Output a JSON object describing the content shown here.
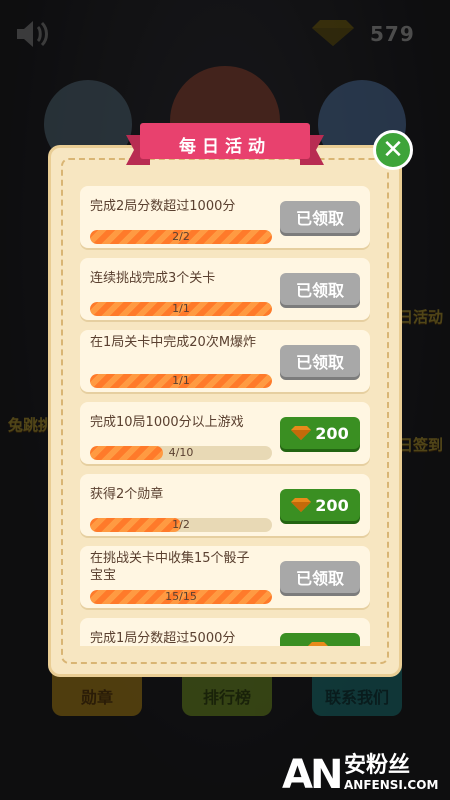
{
  "hud": {
    "gem_count": "579"
  },
  "background": {
    "side_right_1": "日活动",
    "side_right_2": "日签到",
    "side_left_1": "兔跳挑",
    "bottom_buttons": [
      "勋章",
      "排行榜",
      "联系我们"
    ]
  },
  "dialog": {
    "title": "每日活动",
    "close_label": "✕",
    "tasks": [
      {
        "title": "完成2局分数超过1000分",
        "progress_text": "2/2",
        "progress": 1.0,
        "status": "claimed",
        "button": "已领取"
      },
      {
        "title": "连续挑战完成3个关卡",
        "progress_text": "1/1",
        "progress": 1.0,
        "status": "claimed",
        "button": "已领取"
      },
      {
        "title": "在1局关卡中完成20次M爆炸",
        "progress_text": "1/1",
        "progress": 1.0,
        "status": "claimed",
        "button": "已领取"
      },
      {
        "title": "完成10局1000分以上游戏",
        "progress_text": "4/10",
        "progress": 0.4,
        "status": "reward",
        "button": "200"
      },
      {
        "title": "获得2个勋章",
        "progress_text": "1/2",
        "progress": 0.5,
        "status": "reward",
        "button": "200"
      },
      {
        "title": "在挑战关卡中收集15个骰子宝宝",
        "progress_text": "15/15",
        "progress": 1.0,
        "status": "claimed",
        "button": "已领取"
      },
      {
        "title": "完成1局分数超过5000分",
        "progress_text": "",
        "progress": 0,
        "status": "reward",
        "button": ""
      }
    ]
  },
  "watermark": {
    "brand": "AN",
    "cn": "安粉丝",
    "en": "ANFENSI.COM"
  },
  "colors": {
    "ribbon": "#e8416e",
    "claimed": "#a8a8a8",
    "reward": "#3a8f22",
    "close": "#3ea43a",
    "progress": "#ff7a2a"
  }
}
